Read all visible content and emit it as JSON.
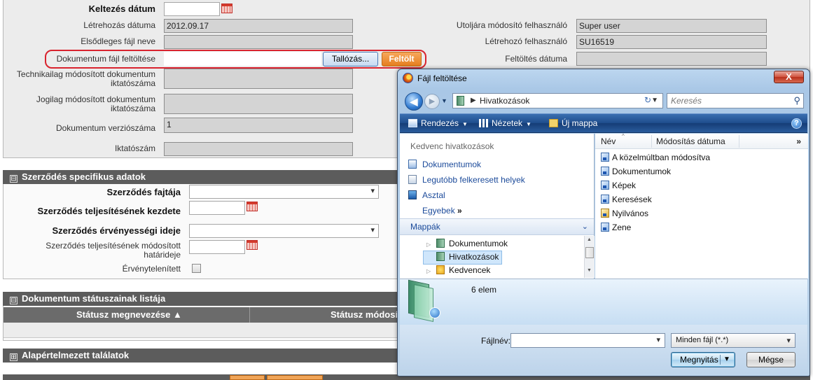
{
  "form": {
    "keltezes_label": "Keltezés dátum",
    "letrehozas_label": "Létrehozás dátuma",
    "letrehozas_value": "2012.09.17",
    "elsodleges_label": "Elsődleges fájl neve",
    "upload_label": "Dokumentum fájl feltöltése",
    "browse_button": "Tallózás...",
    "upload_button": "Feltölt",
    "technikai_label_1": "Technikailag módosított dokumentum",
    "technikai_label_2": "iktatószáma",
    "jogilag_label_1": "Jogilag módosított dokumentum",
    "jogilag_label_2": "iktatószáma",
    "verzio_label": "Dokumentum verziószáma",
    "verzio_value": "1",
    "iktato_label": "Iktatószám",
    "modosito_label": "Utoljára módosító felhasználó",
    "modosito_value": "Super user",
    "letrehozo_label": "Létrehozó felhasználó",
    "letrehozo_value": "SU16519",
    "feltoltes_label": "Feltöltés dátuma"
  },
  "contract": {
    "section_title": "Szerződés specifikus adatok",
    "collapse_symbol": "⊟",
    "fajta_label": "Szerződés fajtája",
    "kezdete_label": "Szerződés teljesítésének kezdete",
    "ervenyessegi_label": "Szerződés érvényességi ideje",
    "modositott_label_1": "Szerződés teljesítésének módosított",
    "modositott_label_2": "határideje",
    "ervenytelen_label": "Érvénytelenített"
  },
  "status_list": {
    "section_title": "Dokumentum státuszainak listája",
    "collapse_symbol": "⊟",
    "col1": "Státusz megnevezése ▲",
    "col2": "Státusz módosí"
  },
  "defaults": {
    "section_title": "Alapértelmezett találatok",
    "expand_symbol": "⊞"
  },
  "dialog": {
    "title": "Fájl feltöltése",
    "close_label": "X",
    "back_glyph": "◀",
    "forward_glyph": "▶",
    "address": "Hivatkozások",
    "address_arrow": "▶",
    "search_placeholder": "Keresés",
    "toolbar": {
      "rendezes": "Rendezés",
      "nezetek": "Nézetek",
      "uj_mappa": "Új mappa",
      "help": "?"
    },
    "favorites_header": "Kedvenc hivatkozások",
    "favorites": [
      "Dokumentumok",
      "Legutóbb felkeresett helyek",
      "Asztal",
      "Egyebek"
    ],
    "more_glyph": "»",
    "folders_header": "Mappák",
    "folders_chevron": "⌄",
    "tree": [
      "Dokumentumok",
      "Hivatkozások",
      "Kedvencek"
    ],
    "columns": {
      "name": "Név",
      "modified": "Módosítás dátuma",
      "more": "»"
    },
    "files": [
      "A közelmúltban módosítva",
      "Dokumentumok",
      "Képek",
      "Keresések",
      "Nyilvános",
      "Zene"
    ],
    "item_count": "6 elem",
    "filename_label": "Fájlnév:",
    "filename_value": "",
    "filter_value": "Minden fájl (*.*)",
    "open_button": "Megnyitás",
    "cancel_button": "Mégse"
  },
  "colors": {
    "highlight_ring": "#d9232e",
    "upload_button": "#e57e1f",
    "section_header": "#5c5c5c",
    "dialog_frame": "#a9c7e6"
  }
}
